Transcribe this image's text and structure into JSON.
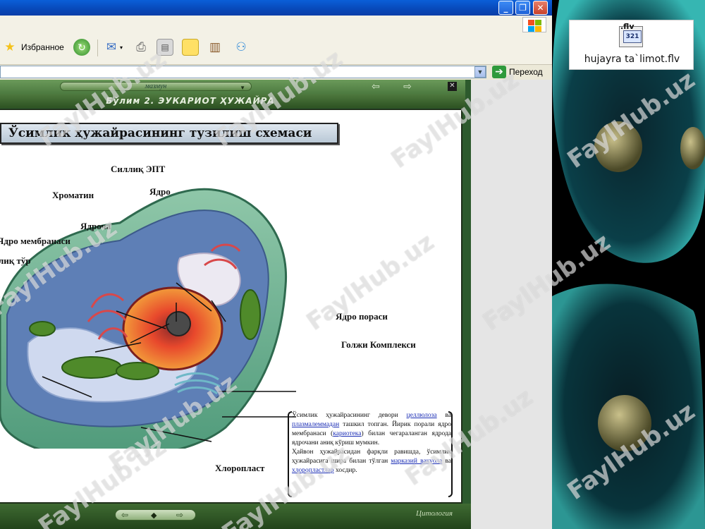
{
  "toolbar": {
    "favorites_label": "Избранное"
  },
  "address_bar": {
    "go_label": "Переход"
  },
  "app": {
    "menu_label": "мазмун",
    "section_title": "Бўлим 2.  ЭУКАРИОТ ҲУЖАЙРА",
    "footer_label": "Цитология"
  },
  "slide": {
    "heading": "Ўсимлик ҳужайрасининг тузилиш схемаси",
    "labels": {
      "silliq_ept": "Силлиқ ЭПТ",
      "xromatin": "Хроматин",
      "yadro": "Ядро",
      "yadrocha": "Ядроча",
      "yadro_membranasi": "Ядро мембранаси",
      "tur": "лиқ тўр",
      "yadro_porasi": "Ядро пораси",
      "golji": "Голжи Комплекси",
      "xloroplast": "Хлоропласт"
    },
    "info": {
      "p1_a": "Ўсимлик ҳужайрасининг девори",
      "p1_hl1": "целлюлоза",
      "p1_b": "ва",
      "p1_hl2": "плазмалеммадан",
      "p1_c": "ташкил топган. Йирик порали ядро мембранаси (",
      "p1_hl3": "кариотека",
      "p1_d": ") билан чегараланган ядрода ядрочани аниқ кўриш мумкин.",
      "p2_a": "Ҳайвон ҳужайрасидан фарқли равишда, ўсимлик ҳужайрасига шира билан тўлган",
      "p2_hl1": "марказий вакуола",
      "p2_b": "ва",
      "p2_hl2": "хлоропластлар",
      "p2_c": "хосдир."
    }
  },
  "desktop": {
    "file_name": "hujayra ta`limot.flv",
    "file_thumb_text": ".flv"
  },
  "watermark": "FaylHub.uz"
}
